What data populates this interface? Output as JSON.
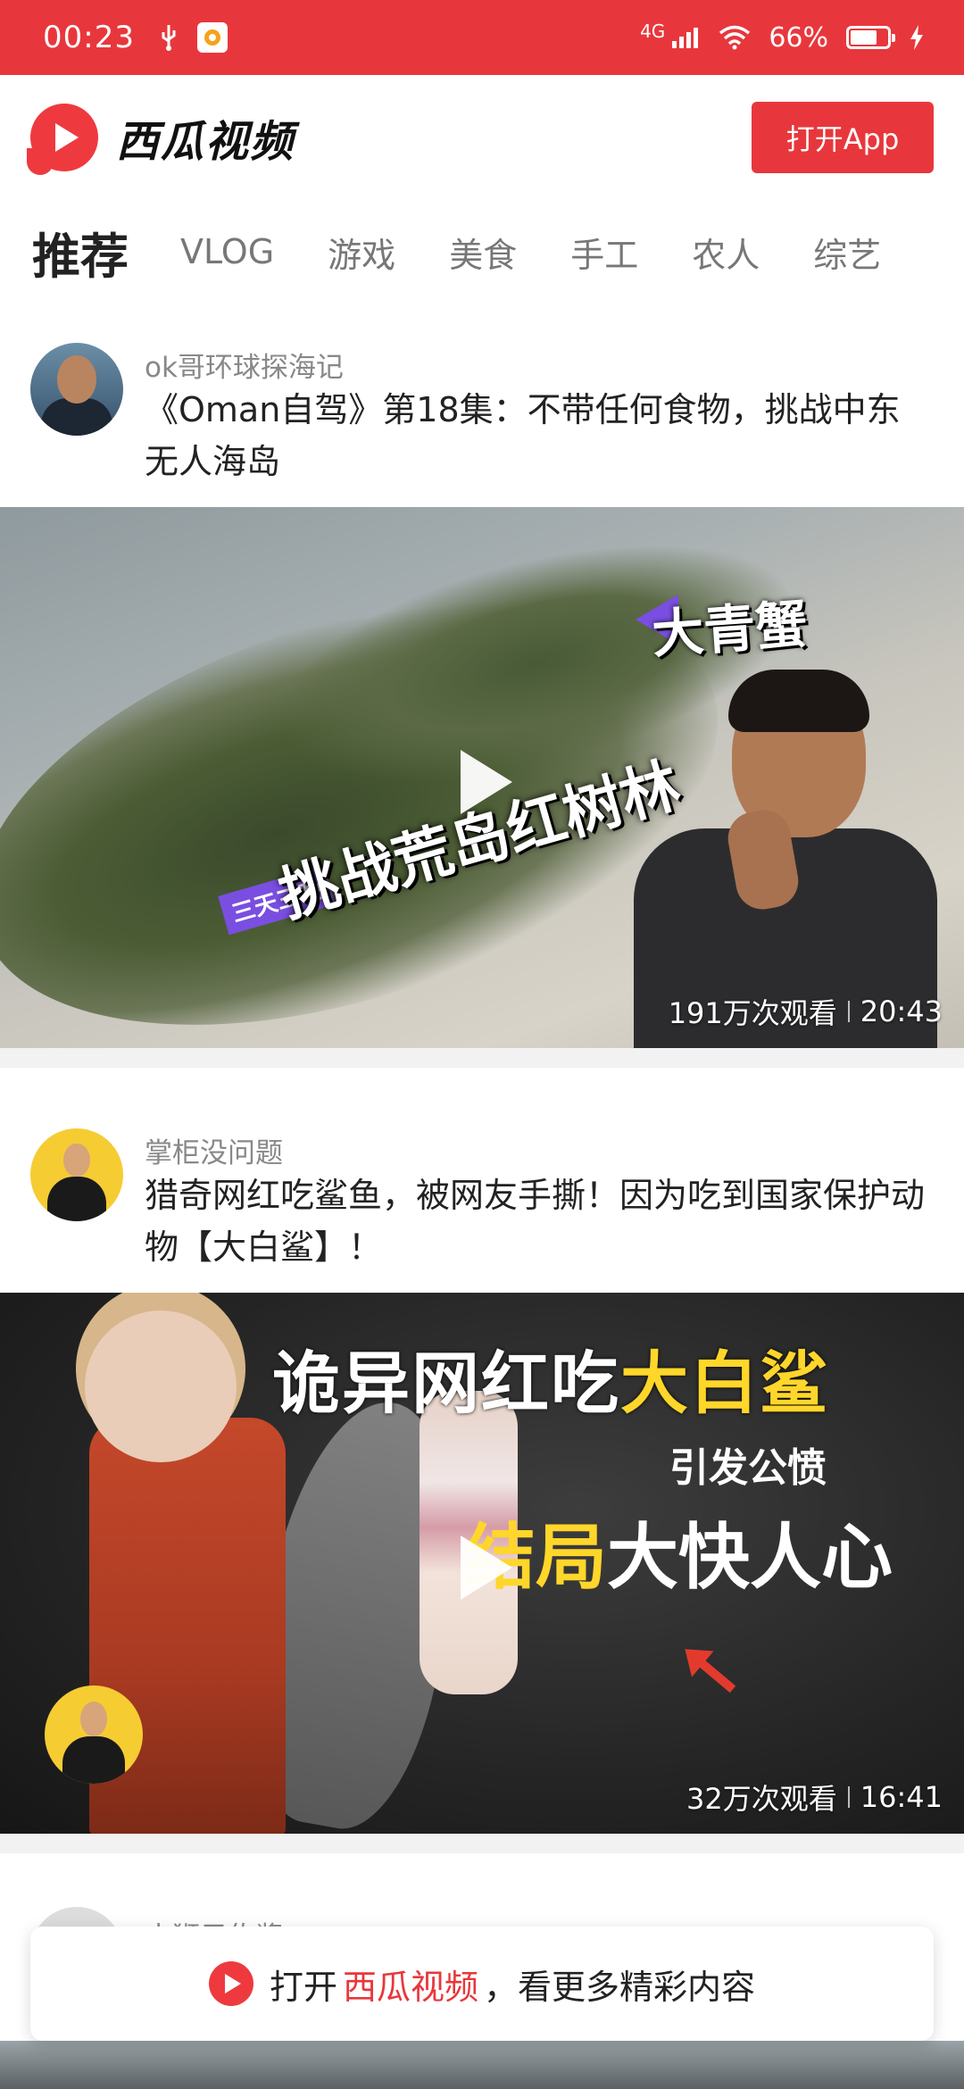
{
  "status_bar": {
    "time": "00:23",
    "network": "4G",
    "battery": "66%",
    "battery_level": 0.66
  },
  "header": {
    "app_name": "西瓜视频",
    "open_app_label": "打开App"
  },
  "tabs": [
    {
      "label": "推荐",
      "active": true
    },
    {
      "label": "VLOG"
    },
    {
      "label": "游戏"
    },
    {
      "label": "美食"
    },
    {
      "label": "手工"
    },
    {
      "label": "农人"
    },
    {
      "label": "综艺"
    }
  ],
  "feed": [
    {
      "author": "ok哥环球探海记",
      "title": "《Oman自驾》第18集：不带任何食物，挑战中东无人海岛",
      "views": "191万次观看",
      "duration": "20:43",
      "thumb_text": {
        "main": "挑战荒岛红树林",
        "tag": "三天三晚",
        "pointer": "大青蟹"
      }
    },
    {
      "author": "掌柜没问题",
      "title": "猎奇网红吃鲨鱼，被网友手撕！因为吃到国家保护动物【大白鲨】！",
      "views": "32万次观看",
      "duration": "16:41",
      "thumb_text": {
        "line1_a": "诡异网红吃",
        "line1_b": "大白鲨",
        "line2": "引发公愤",
        "line3_a": "结局",
        "line3_b": "大快人心"
      }
    },
    {
      "author": "小狮子佐酱"
    }
  ],
  "banner": {
    "prefix": "打开",
    "app_name": "西瓜视频",
    "suffix": "，看更多精彩内容"
  },
  "colors": {
    "brand_red": "#e8373c",
    "highlight_yellow": "#ffd62a",
    "tag_purple": "#7a4ee0"
  },
  "icons": [
    "usb-icon",
    "mini-app-icon",
    "signal-icon",
    "wifi-icon",
    "battery-icon",
    "charging-icon",
    "xigua-logo-icon",
    "play-icon"
  ]
}
